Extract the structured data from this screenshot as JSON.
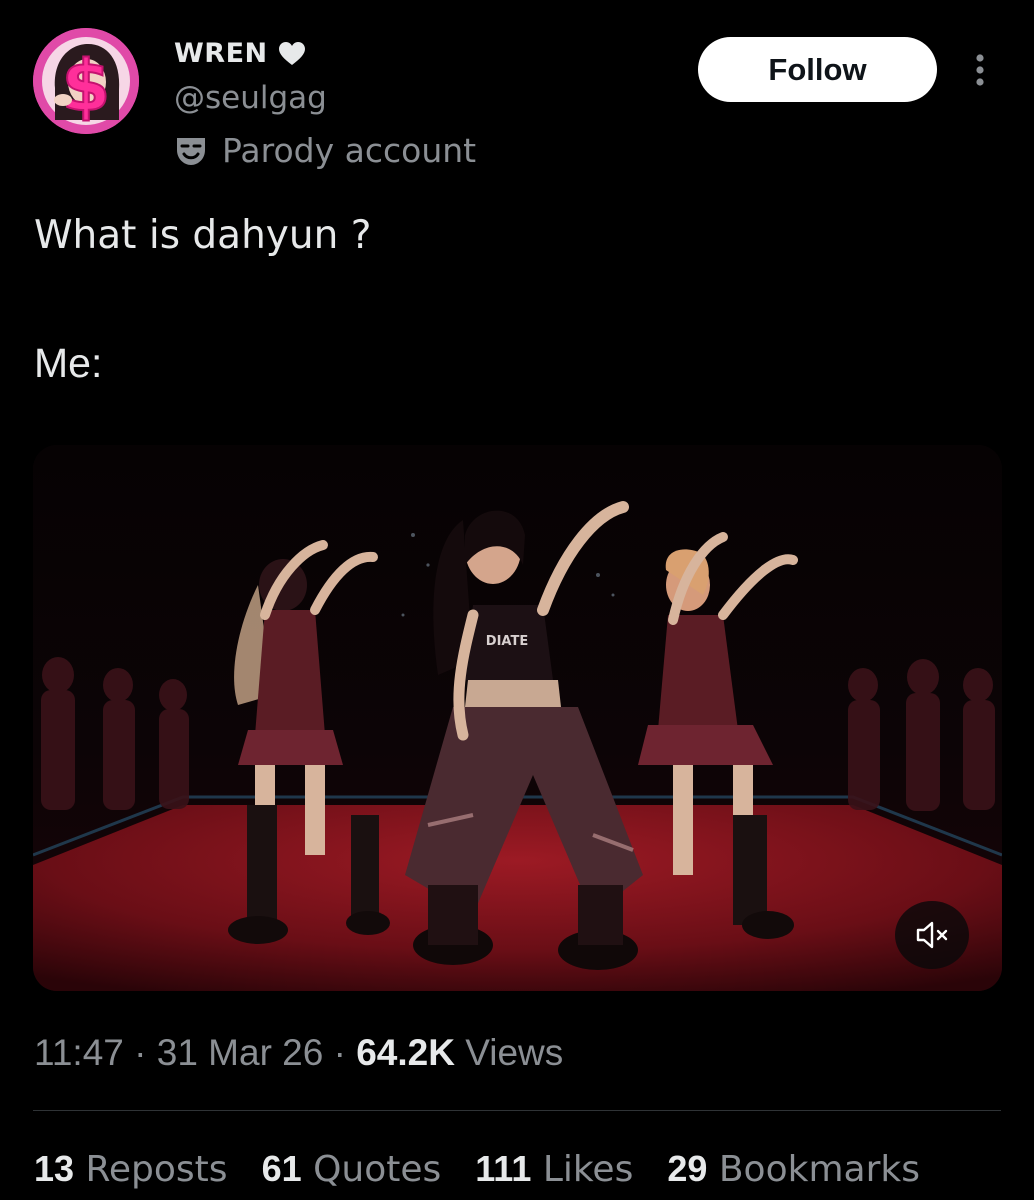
{
  "author": {
    "display_name": "WREN",
    "handle": "@seulgag",
    "label": "Parody account",
    "name_icon": "heart-icon",
    "label_icon": "theater-mask-icon",
    "avatar_icon": "dollar-sign-icon"
  },
  "follow_button": {
    "label": "Follow"
  },
  "more_menu": {
    "icon": "more-vertical-icon"
  },
  "tweet": {
    "line1": "What is dahyun ?",
    "line2": "Me:"
  },
  "media": {
    "type": "video",
    "mute_icon": "speaker-muted-icon"
  },
  "meta": {
    "time": "11:47",
    "separator": " · ",
    "date": "31 Mar 26",
    "views_count": "64.2K",
    "views_label": "Views"
  },
  "stats": [
    {
      "count": "13",
      "label": "Reposts"
    },
    {
      "count": "61",
      "label": "Quotes"
    },
    {
      "count": "111",
      "label": "Likes"
    },
    {
      "count": "29",
      "label": "Bookmarks"
    }
  ],
  "colors": {
    "background": "#000000",
    "primary_text": "#e7e9ea",
    "secondary_text": "#8b8f94",
    "divider": "#2f3336",
    "avatar_ring": "#e04aa8",
    "follow_bg": "#ffffff"
  }
}
